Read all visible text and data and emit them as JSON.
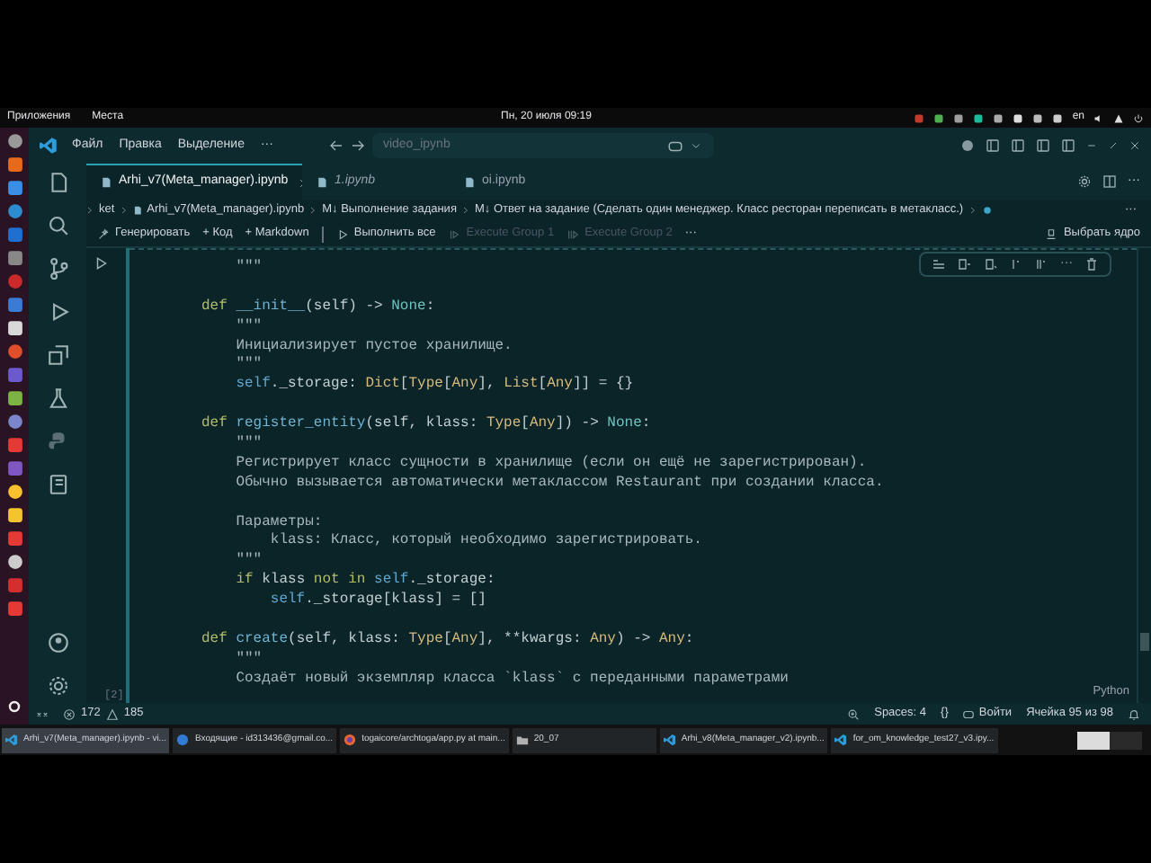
{
  "top_panel": {
    "menus": [
      "Приложения",
      "Места"
    ],
    "clock": "Пн, 20 июля 09:19",
    "keyboard_layout": "en"
  },
  "title_bar": {
    "menus": [
      "Файл",
      "Правка",
      "Выделение",
      "···"
    ],
    "search": "video_ipynb"
  },
  "tabs": [
    {
      "label": "Arhi_v7(Meta_manager).ipynb",
      "selected": true
    },
    {
      "label": "1.ipynb",
      "selected": false
    },
    {
      "label": "oi.ipynb",
      "selected": false
    }
  ],
  "tab_actions": {
    "more": "···"
  },
  "breadcrumb": [
    "ket",
    "Arhi_v7(Meta_manager).ipynb",
    "M↓ Выполнение задания",
    "M↓ Ответ на задание (Сделать один менеджер. Класс ресторан переписать в метакласс.)"
  ],
  "breadcrumb_more": "···",
  "notebook_toolbar": [
    {
      "label": "Генерировать",
      "disabled": false
    },
    {
      "label": "+ Код",
      "disabled": false
    },
    {
      "label": "+ Markdown",
      "disabled": false
    },
    {
      "label": "Выполнить все",
      "disabled": false
    },
    {
      "label": "Execute Group 1",
      "disabled": true
    },
    {
      "label": "Execute Group 2",
      "disabled": true
    },
    {
      "label": "···",
      "disabled": false
    }
  ],
  "kernel": "Выбрать ядро",
  "cell": {
    "execution_count": "[2]",
    "language": "Python",
    "toolbar_more": "···",
    "lines": [
      [
        {
          "kind": "string",
          "text": "    \"\"\""
        }
      ],
      [
        {
          "kind": "keyword",
          "text": "def ",
          "gap_before": true
        },
        {
          "kind": "function",
          "text": "__init__"
        },
        {
          "kind": "plain",
          "text": "(self) -> "
        },
        {
          "kind": "builtin",
          "text": "None"
        },
        {
          "kind": "plain",
          "text": ":"
        }
      ],
      [
        {
          "kind": "string",
          "text": "    \"\"\""
        }
      ],
      [
        {
          "kind": "string",
          "text": "    Инициализирует пустое хранилище."
        }
      ],
      [
        {
          "kind": "string",
          "text": "    \"\"\""
        }
      ],
      [
        {
          "kind": "self",
          "text": "    self"
        },
        {
          "kind": "plain",
          "text": "._storage: "
        },
        {
          "kind": "type",
          "text": "Dict"
        },
        {
          "kind": "plain",
          "text": "["
        },
        {
          "kind": "type",
          "text": "Type"
        },
        {
          "kind": "plain",
          "text": "["
        },
        {
          "kind": "type",
          "text": "Any"
        },
        {
          "kind": "plain",
          "text": "], "
        },
        {
          "kind": "type",
          "text": "List"
        },
        {
          "kind": "plain",
          "text": "["
        },
        {
          "kind": "type",
          "text": "Any"
        },
        {
          "kind": "plain",
          "text": "]] = {}"
        }
      ],
      [
        {
          "kind": "keyword",
          "text": "def ",
          "gap_before": true
        },
        {
          "kind": "function",
          "text": "register_entity"
        },
        {
          "kind": "plain",
          "text": "(self, klass: "
        },
        {
          "kind": "type",
          "text": "Type"
        },
        {
          "kind": "plain",
          "text": "["
        },
        {
          "kind": "type",
          "text": "Any"
        },
        {
          "kind": "plain",
          "text": "]) -> "
        },
        {
          "kind": "builtin",
          "text": "None"
        },
        {
          "kind": "plain",
          "text": ":"
        }
      ],
      [
        {
          "kind": "string",
          "text": "    \"\"\""
        }
      ],
      [
        {
          "kind": "string",
          "text": "    Регистрирует класс сущности в хранилище (если он ещё не зарегистрирован)."
        }
      ],
      [
        {
          "kind": "string",
          "text": "    Обычно вызывается автоматически метаклассом Restaurant при создании класса."
        }
      ],
      [
        {
          "kind": "string",
          "text": "    Параметры:",
          "gap_before": true
        }
      ],
      [
        {
          "kind": "string",
          "text": "        klass: Класс, который необходимо зарегистрировать."
        }
      ],
      [
        {
          "kind": "string",
          "text": "    \"\"\""
        }
      ],
      [
        {
          "kind": "keyword",
          "text": "    if "
        },
        {
          "kind": "plain",
          "text": "klass "
        },
        {
          "kind": "keyword",
          "text": "not in "
        },
        {
          "kind": "self",
          "text": "self"
        },
        {
          "kind": "plain",
          "text": "._storage:"
        }
      ],
      [
        {
          "kind": "self",
          "text": "        self"
        },
        {
          "kind": "plain",
          "text": "._storage[klass] = []"
        }
      ],
      [
        {
          "kind": "keyword",
          "text": "def ",
          "gap_before": true
        },
        {
          "kind": "function",
          "text": "create"
        },
        {
          "kind": "plain",
          "text": "(self, klass: "
        },
        {
          "kind": "type",
          "text": "Type"
        },
        {
          "kind": "plain",
          "text": "["
        },
        {
          "kind": "type",
          "text": "Any"
        },
        {
          "kind": "plain",
          "text": "], **kwargs: "
        },
        {
          "kind": "type",
          "text": "Any"
        },
        {
          "kind": "plain",
          "text": ") -> "
        },
        {
          "kind": "type",
          "text": "Any"
        },
        {
          "kind": "plain",
          "text": ":"
        }
      ],
      [
        {
          "kind": "string",
          "text": "    \"\"\""
        }
      ],
      [
        {
          "kind": "string",
          "text": "    Создаёт новый экземпляр класса `klass` с переданными параметрами"
        }
      ]
    ]
  },
  "status_bar": {
    "errors": "172",
    "warnings": "185",
    "spaces": "Spaces: 4",
    "braces": "{}",
    "account": "Войти",
    "cell_position": "Ячейка 95 из 98"
  },
  "taskbar": [
    {
      "label": "Arhi_v7(Meta_manager).ipynb - vi...",
      "selected": true,
      "kind": "vscode"
    },
    {
      "label": "Входящие - id313436@gmail.co...",
      "selected": false,
      "kind": "mail"
    },
    {
      "label": "togaicore/archtoga/app.py at main...",
      "selected": false,
      "kind": "browser"
    },
    {
      "label": "20_07",
      "selected": false,
      "kind": "folder"
    },
    {
      "label": "Arhi_v8(Meta_manager_v2).ipynb...",
      "selected": false,
      "kind": "vscode"
    },
    {
      "label": "for_om_knowledge_test27_v3.ipy...",
      "selected": false,
      "kind": "vscode"
    }
  ]
}
